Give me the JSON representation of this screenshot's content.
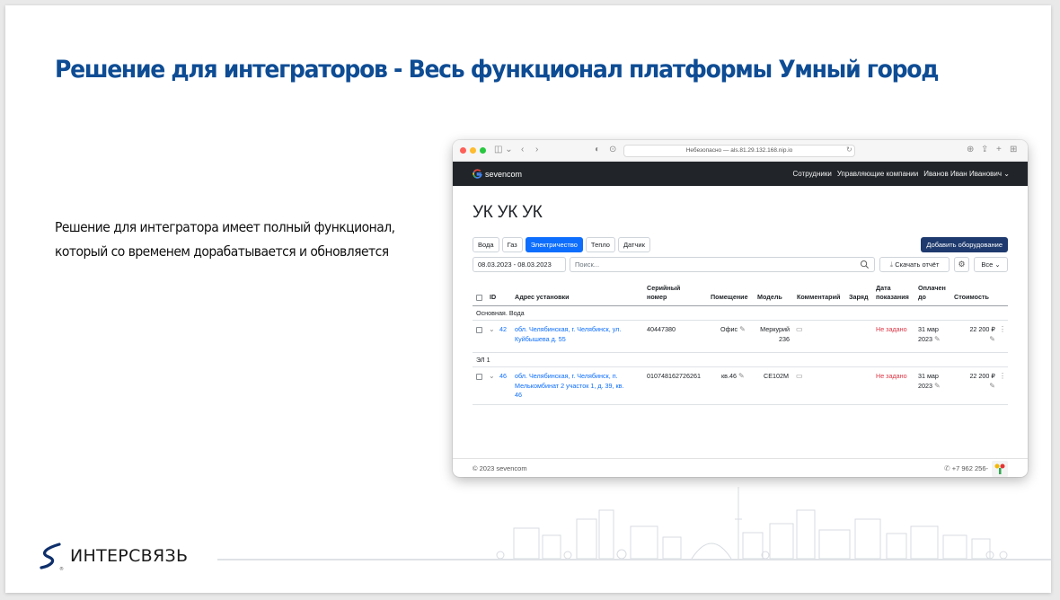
{
  "slide": {
    "title": "Решение для интеграторов - Весь функционал платформы Умный город",
    "body_line1": "Решение для интегратора имеет полный функционал,",
    "body_line2": "который со временем дорабатывается и обновляется",
    "company_name": "ИНТЕРСВЯЗЬ",
    "logo_reg": "®"
  },
  "browser": {
    "url": "Небезопасно — als.81.29.132.168.nip.io",
    "brand": "sevencom",
    "nav": [
      "Сотрудники",
      "Управляющие компании",
      "Иванов Иван Иванович ⌄"
    ],
    "page_title": "УК УК УК",
    "tabs": [
      "Вода",
      "Газ",
      "Электричество",
      "Тепло",
      "Датчик"
    ],
    "active_tab": "Электричество",
    "add_button": "Добавить оборудование",
    "date_range": "08.03.2023 - 08.03.2023",
    "search_placeholder": "Поиск...",
    "download_button": "Скачать отчёт",
    "all_button": "Все",
    "footer_copy": "© 2023 sevencom",
    "footer_phone": "+7 962 256-"
  },
  "table": {
    "headers": {
      "id": "ID",
      "address": "Адрес установки",
      "serial_1": "Серийный",
      "serial_2": "номер",
      "room": "Помещение",
      "model": "Модель",
      "comment": "Комментарий",
      "charge": "Заряд",
      "date_1": "Дата",
      "date_2": "показания",
      "paid_1": "Оплачен",
      "paid_2": "до",
      "cost": "Стоимость"
    },
    "groups": [
      {
        "name": "Основная. Вода",
        "row": {
          "id": "42",
          "address_1": "обл. Челябинская, г. Челябинск, ул.",
          "address_2": "Куйбышева д. 55",
          "address_3": "",
          "serial": "40447380",
          "room": "Офис",
          "model_1": "Меркурий",
          "model_2": "236",
          "reading": "Не задано",
          "paid_1": "31 мар",
          "paid_2": "2023",
          "cost": "22 200 ₽"
        }
      },
      {
        "name": "ЭЛ 1",
        "row": {
          "id": "46",
          "address_1": "обл. Челябинская, г. Челябинск, п.",
          "address_2": "Мелькомбинат 2 участок 1, д. 39, кв.",
          "address_3": "46",
          "serial": "010748162726261",
          "room": "кв.46",
          "model_1": "CE102M",
          "model_2": "",
          "reading": "Не задано",
          "paid_1": "31 мар",
          "paid_2": "2023",
          "cost": "22 200 ₽"
        }
      }
    ]
  },
  "colors": {
    "title_blue": "#0e4c94",
    "navbar_dark": "#212529",
    "primary_blue": "#0d6efd",
    "add_button_navy": "#1e3a6e",
    "not_set_red": "#dc3545"
  }
}
